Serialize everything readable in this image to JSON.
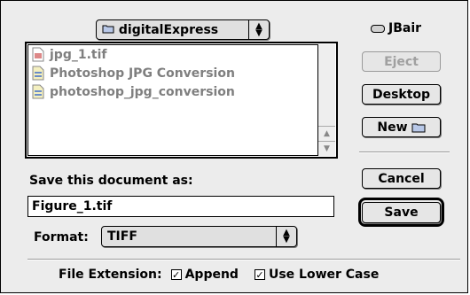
{
  "location_popup": {
    "label": "digitalExpress",
    "icon": "folder-icon"
  },
  "volume": {
    "label": "JBair",
    "icon": "disk-icon"
  },
  "files": [
    {
      "name": "jpg_1.tif",
      "icon": "tiff-file-icon"
    },
    {
      "name": "Photoshop JPG Conversion",
      "icon": "document-icon"
    },
    {
      "name": "photoshop_jpg_conversion",
      "icon": "document-icon"
    }
  ],
  "buttons": {
    "eject": "Eject",
    "desktop": "Desktop",
    "new": "New",
    "cancel": "Cancel",
    "save": "Save"
  },
  "save_as": {
    "label": "Save this document as:",
    "value": "Figure_1.tif"
  },
  "format": {
    "label": "Format:",
    "value": "TIFF"
  },
  "extension": {
    "label": "File Extension:",
    "append_label": "Append",
    "append_checked": true,
    "lowercase_label": "Use Lower Case",
    "lowercase_checked": true
  }
}
